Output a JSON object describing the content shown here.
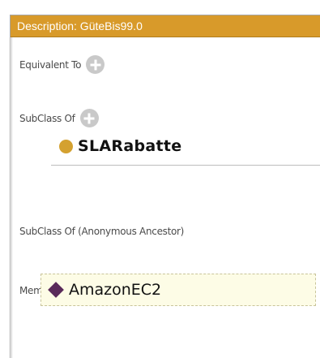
{
  "header": {
    "title": "Description: GüteBis99.0"
  },
  "sections": {
    "equivalent_to": {
      "label": "Equivalent To"
    },
    "subclass_of": {
      "label": "SubClass Of",
      "items": [
        {
          "name": "SLARabatte"
        }
      ]
    },
    "subclass_of_anon": {
      "label": "SubClass Of (Anonymous Ancestor)"
    },
    "members": {
      "label": "Members",
      "items": [
        {
          "name": "AmazonEC2"
        }
      ]
    }
  },
  "colors": {
    "header_bg": "#d89a2a",
    "class_dot": "#d4a130",
    "individual_diamond": "#5a2a5a",
    "add_button": "#c9c9c9"
  },
  "icons": {
    "add": "plus-circle-icon",
    "class": "class-circle-icon",
    "individual": "individual-diamond-icon"
  }
}
